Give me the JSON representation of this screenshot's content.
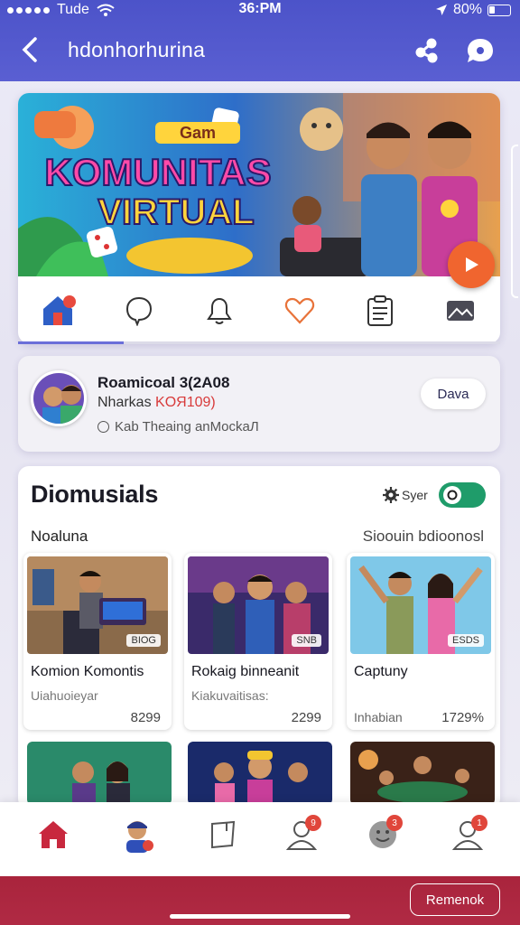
{
  "status": {
    "carrier": "Tude",
    "time": "36:PM",
    "battery": "80%"
  },
  "header": {
    "title": "hdonhorhurina"
  },
  "hero": {
    "badge_text": "Gam",
    "headline_line1": "KOMUNITAS",
    "headline_line2": "VIRTUAL",
    "progress": 0.22
  },
  "hero_icons": [
    "home-icon",
    "chat-icon",
    "bell-icon",
    "heart-icon",
    "clipboard-icon",
    "image-icon"
  ],
  "profile": {
    "name": "Roamicoal 3(2A08",
    "sub_prefix": "Nharkas",
    "sub_accent": "KOЯ109)",
    "status": "Kab  Theaing anMockaЛ",
    "button": "Dava"
  },
  "main": {
    "title": "Diomusials",
    "filter_label": "Syer",
    "toggle_on": true,
    "section_left": "Noaluna",
    "section_right": "Sioouin bdioonosl"
  },
  "games": [
    {
      "title": "Komion Komontis",
      "subtitle": "Uiahuoieyar",
      "price": "8299",
      "price_left": "",
      "badge": "BIOG"
    },
    {
      "title": "Rokaig binneanit",
      "subtitle": "Kiakuvaitisas:",
      "price": "2299",
      "price_left": "",
      "badge": "SNB"
    },
    {
      "title": "Captuny",
      "subtitle": "",
      "price": "1729%",
      "price_left": "Inhabian",
      "badge": "ESDS"
    }
  ],
  "bottom_nav": {
    "badges": [
      "",
      "",
      "",
      "9",
      "3",
      "1"
    ]
  },
  "footer": {
    "cta": "Remenok"
  },
  "colors": {
    "header": "#4c53c9",
    "accent": "#f0652f",
    "toggle": "#1f9c6a",
    "footer": "#a9243c"
  }
}
